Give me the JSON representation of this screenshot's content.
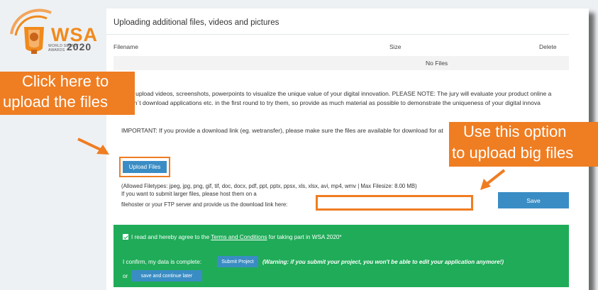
{
  "logo": {
    "wordmark": "WSA",
    "subtitle": "WORLD SUMMIT AWARDS",
    "year": "2020"
  },
  "section": {
    "title": "Uploading additional files, videos and pictures"
  },
  "files_table": {
    "headers": [
      "Filename",
      "Size",
      "Delete"
    ],
    "empty_text": "No Files"
  },
  "info": {
    "line1": "e upload videos, screenshots, powerpoints to visualize the unique value of your digital innovation. PLEASE NOTE: The jury will evaluate your product online a",
    "line2": "on´t download applications etc. in the first round to try them, so provide as much material as possible to demonstrate the uniqueness of your digital innova",
    "important": "IMPORTANT: If you provide a download link (eg. wetransfer), please make sure the files are available for download for at"
  },
  "upload": {
    "button_label": "Upload Files",
    "allowed_types": "(Allowed Filetypes: jpeg, jpg, png, gif, tif, doc, docx, pdf, ppt, pptx, ppsx, xls, xlsx, avi, mp4, wmv | Max Filesize: 8.00 MB)",
    "larger_line1": "If you want to submit larger files, please host them on a",
    "larger_line2": "filehoster or your FTP server and provide us the download link here:",
    "link_value": "",
    "save_label": "Save"
  },
  "agreement": {
    "checked": true,
    "prefix": "I read and hereby agree to the ",
    "terms_link": "Terms and Conditions",
    "suffix": " for taking part in WSA 2020*",
    "confirm_text": "I confirm, my data is complete:",
    "submit_label": "Submit Project",
    "warning": "(Warning: if you submit your project, you won't be able to edit your application anymore!)",
    "or_text": "or",
    "later_label": "save and continue later"
  },
  "callouts": {
    "left_line1": "Click here to",
    "left_line2": "upload the files",
    "right_line1": "Use this option",
    "right_line2": "to upload big files"
  },
  "colors": {
    "accent_orange": "#ef7d22",
    "button_blue": "#3a8dc4",
    "agree_green": "#1fab58"
  }
}
